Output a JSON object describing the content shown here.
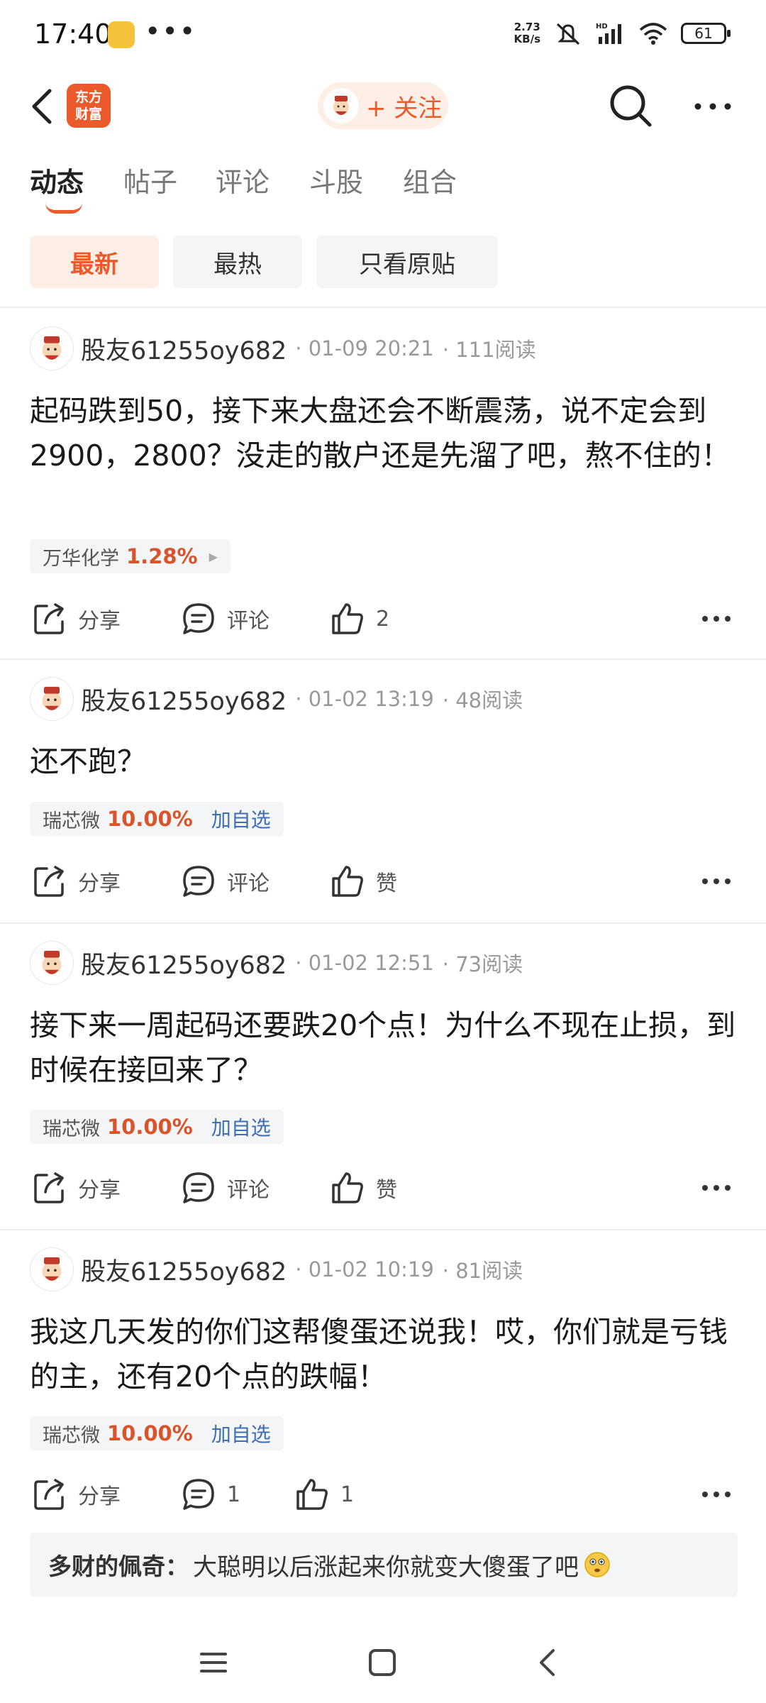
{
  "status_bar": {
    "time": "17:40",
    "speed_value": "2.73",
    "speed_unit": "KB/s",
    "battery": "61",
    "icons": [
      "app-notification-icon",
      "mute-icon",
      "signal-icon",
      "wifi-icon",
      "battery-icon"
    ]
  },
  "header": {
    "logo_line1": "东方",
    "logo_line2": "财富",
    "follow_label": "+ 关注"
  },
  "tabs": [
    {
      "label": "动态",
      "active": true
    },
    {
      "label": "帖子",
      "active": false
    },
    {
      "label": "评论",
      "active": false
    },
    {
      "label": "斗股",
      "active": false
    },
    {
      "label": "组合",
      "active": false
    }
  ],
  "filters": [
    {
      "label": "最新",
      "active": true
    },
    {
      "label": "最热",
      "active": false
    },
    {
      "label": "只看原贴",
      "active": false
    }
  ],
  "posts": [
    {
      "author": "股友61255oy682",
      "time": "· 01-09 20:21",
      "reads": "· 111阅读",
      "content": "起码跌到50，接下来大盘还会不断震荡，说不定会到2900，2800？没走的散户还是先溜了吧，熬不住的！",
      "stock_name": "万华化学",
      "stock_change": "1.28%",
      "stock_add": "",
      "share_label": "分享",
      "comment_label": "评论",
      "like_label": "2"
    },
    {
      "author": "股友61255oy682",
      "time": "· 01-02 13:19",
      "reads": "· 48阅读",
      "content": "还不跑？",
      "stock_name": "瑞芯微",
      "stock_change": "10.00%",
      "stock_add": "加自选",
      "share_label": "分享",
      "comment_label": "评论",
      "like_label": "赞"
    },
    {
      "author": "股友61255oy682",
      "time": "· 01-02 12:51",
      "reads": "· 73阅读",
      "content": "接下来一周起码还要跌20个点！为什么不现在止损，到时候在接回来了？",
      "stock_name": "瑞芯微",
      "stock_change": "10.00%",
      "stock_add": "加自选",
      "share_label": "分享",
      "comment_label": "评论",
      "like_label": "赞"
    },
    {
      "author": "股友61255oy682",
      "time": "· 01-02 10:19",
      "reads": "· 81阅读",
      "content": "我这几天发的你们这帮傻蛋还说我！哎，你们就是亏钱的主，还有20个点的跌幅！",
      "stock_name": "瑞芯微",
      "stock_change": "10.00%",
      "stock_add": "加自选",
      "share_label": "分享",
      "comment_label": "1",
      "like_label": "1"
    }
  ],
  "reply": {
    "author": "多财的佩奇：",
    "text": "大聪明以后涨起来你就变大傻蛋了吧",
    "emoji": "thinking-face-emoji"
  },
  "colors": {
    "accent": "#ea5a2b",
    "accent_bg": "#fdeee6",
    "stock_up": "#d9542b",
    "link_blue": "#3e6fb5"
  }
}
